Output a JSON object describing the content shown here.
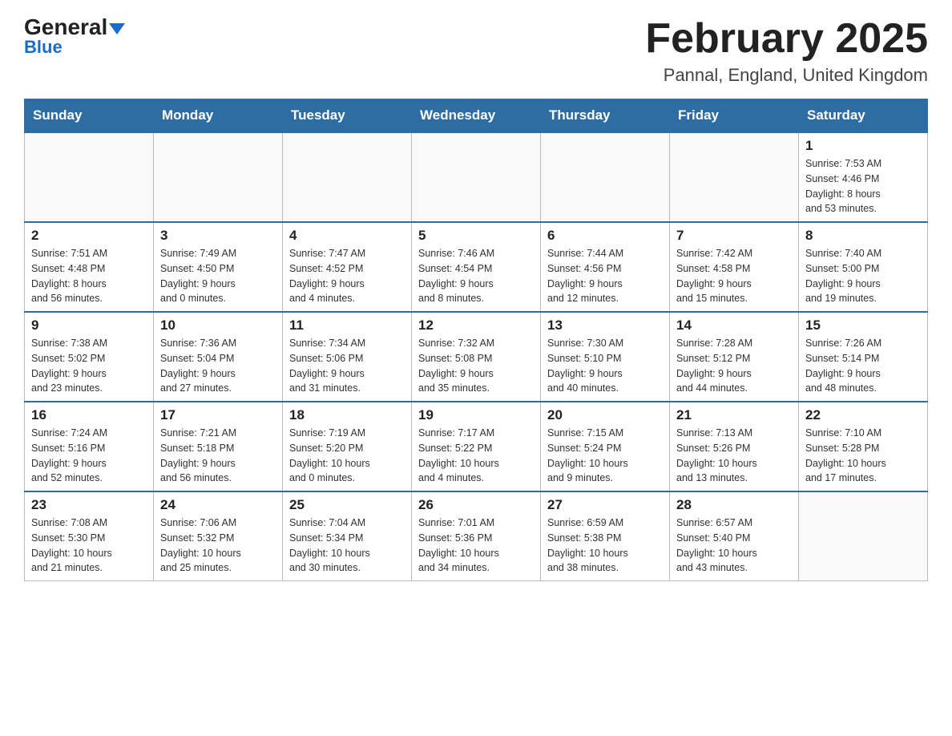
{
  "logo": {
    "line1": "General",
    "line2": "Blue"
  },
  "title": "February 2025",
  "subtitle": "Pannal, England, United Kingdom",
  "weekdays": [
    "Sunday",
    "Monday",
    "Tuesday",
    "Wednesday",
    "Thursday",
    "Friday",
    "Saturday"
  ],
  "weeks": [
    [
      {
        "day": "",
        "info": ""
      },
      {
        "day": "",
        "info": ""
      },
      {
        "day": "",
        "info": ""
      },
      {
        "day": "",
        "info": ""
      },
      {
        "day": "",
        "info": ""
      },
      {
        "day": "",
        "info": ""
      },
      {
        "day": "1",
        "info": "Sunrise: 7:53 AM\nSunset: 4:46 PM\nDaylight: 8 hours\nand 53 minutes."
      }
    ],
    [
      {
        "day": "2",
        "info": "Sunrise: 7:51 AM\nSunset: 4:48 PM\nDaylight: 8 hours\nand 56 minutes."
      },
      {
        "day": "3",
        "info": "Sunrise: 7:49 AM\nSunset: 4:50 PM\nDaylight: 9 hours\nand 0 minutes."
      },
      {
        "day": "4",
        "info": "Sunrise: 7:47 AM\nSunset: 4:52 PM\nDaylight: 9 hours\nand 4 minutes."
      },
      {
        "day": "5",
        "info": "Sunrise: 7:46 AM\nSunset: 4:54 PM\nDaylight: 9 hours\nand 8 minutes."
      },
      {
        "day": "6",
        "info": "Sunrise: 7:44 AM\nSunset: 4:56 PM\nDaylight: 9 hours\nand 12 minutes."
      },
      {
        "day": "7",
        "info": "Sunrise: 7:42 AM\nSunset: 4:58 PM\nDaylight: 9 hours\nand 15 minutes."
      },
      {
        "day": "8",
        "info": "Sunrise: 7:40 AM\nSunset: 5:00 PM\nDaylight: 9 hours\nand 19 minutes."
      }
    ],
    [
      {
        "day": "9",
        "info": "Sunrise: 7:38 AM\nSunset: 5:02 PM\nDaylight: 9 hours\nand 23 minutes."
      },
      {
        "day": "10",
        "info": "Sunrise: 7:36 AM\nSunset: 5:04 PM\nDaylight: 9 hours\nand 27 minutes."
      },
      {
        "day": "11",
        "info": "Sunrise: 7:34 AM\nSunset: 5:06 PM\nDaylight: 9 hours\nand 31 minutes."
      },
      {
        "day": "12",
        "info": "Sunrise: 7:32 AM\nSunset: 5:08 PM\nDaylight: 9 hours\nand 35 minutes."
      },
      {
        "day": "13",
        "info": "Sunrise: 7:30 AM\nSunset: 5:10 PM\nDaylight: 9 hours\nand 40 minutes."
      },
      {
        "day": "14",
        "info": "Sunrise: 7:28 AM\nSunset: 5:12 PM\nDaylight: 9 hours\nand 44 minutes."
      },
      {
        "day": "15",
        "info": "Sunrise: 7:26 AM\nSunset: 5:14 PM\nDaylight: 9 hours\nand 48 minutes."
      }
    ],
    [
      {
        "day": "16",
        "info": "Sunrise: 7:24 AM\nSunset: 5:16 PM\nDaylight: 9 hours\nand 52 minutes."
      },
      {
        "day": "17",
        "info": "Sunrise: 7:21 AM\nSunset: 5:18 PM\nDaylight: 9 hours\nand 56 minutes."
      },
      {
        "day": "18",
        "info": "Sunrise: 7:19 AM\nSunset: 5:20 PM\nDaylight: 10 hours\nand 0 minutes."
      },
      {
        "day": "19",
        "info": "Sunrise: 7:17 AM\nSunset: 5:22 PM\nDaylight: 10 hours\nand 4 minutes."
      },
      {
        "day": "20",
        "info": "Sunrise: 7:15 AM\nSunset: 5:24 PM\nDaylight: 10 hours\nand 9 minutes."
      },
      {
        "day": "21",
        "info": "Sunrise: 7:13 AM\nSunset: 5:26 PM\nDaylight: 10 hours\nand 13 minutes."
      },
      {
        "day": "22",
        "info": "Sunrise: 7:10 AM\nSunset: 5:28 PM\nDaylight: 10 hours\nand 17 minutes."
      }
    ],
    [
      {
        "day": "23",
        "info": "Sunrise: 7:08 AM\nSunset: 5:30 PM\nDaylight: 10 hours\nand 21 minutes."
      },
      {
        "day": "24",
        "info": "Sunrise: 7:06 AM\nSunset: 5:32 PM\nDaylight: 10 hours\nand 25 minutes."
      },
      {
        "day": "25",
        "info": "Sunrise: 7:04 AM\nSunset: 5:34 PM\nDaylight: 10 hours\nand 30 minutes."
      },
      {
        "day": "26",
        "info": "Sunrise: 7:01 AM\nSunset: 5:36 PM\nDaylight: 10 hours\nand 34 minutes."
      },
      {
        "day": "27",
        "info": "Sunrise: 6:59 AM\nSunset: 5:38 PM\nDaylight: 10 hours\nand 38 minutes."
      },
      {
        "day": "28",
        "info": "Sunrise: 6:57 AM\nSunset: 5:40 PM\nDaylight: 10 hours\nand 43 minutes."
      },
      {
        "day": "",
        "info": ""
      }
    ]
  ]
}
